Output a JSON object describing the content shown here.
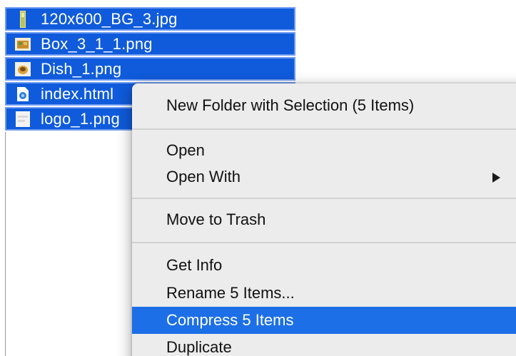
{
  "files": [
    {
      "name": "120x600_BG_3.jpg",
      "icon": "jpg-banner-thumbnail-icon"
    },
    {
      "name": "Box_3_1_1.png",
      "icon": "png-box-thumbnail-icon"
    },
    {
      "name": "Dish_1.png",
      "icon": "png-dish-thumbnail-icon"
    },
    {
      "name": "index.html",
      "icon": "html-document-icon"
    },
    {
      "name": "logo_1.png",
      "icon": "png-logo-thumbnail-icon"
    }
  ],
  "context_menu": {
    "new_folder": "New Folder with Selection (5 Items)",
    "open": "Open",
    "open_with": "Open With",
    "move_to_trash": "Move to Trash",
    "get_info": "Get Info",
    "rename": "Rename 5 Items...",
    "compress": "Compress 5 Items",
    "duplicate": "Duplicate",
    "highlighted_item": "compress",
    "submenu_arrow_icon": "triangle-right-icon"
  },
  "colors": {
    "selection": "#0f5bdb",
    "menu_highlight": "#1c6fe6",
    "menu_background": "#ececec"
  }
}
